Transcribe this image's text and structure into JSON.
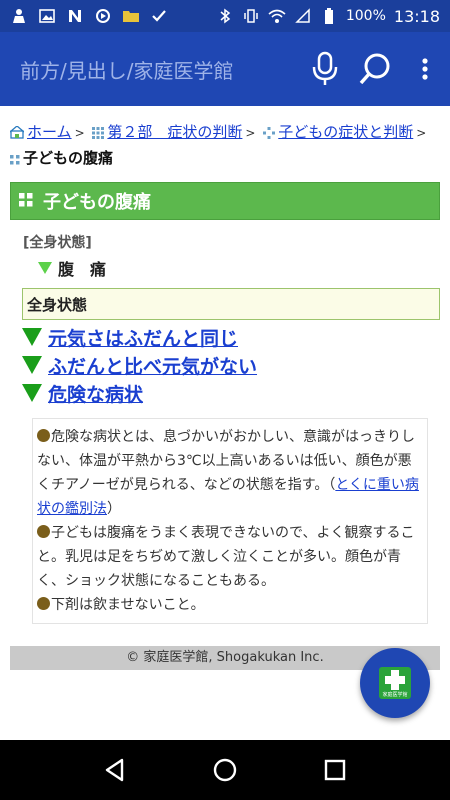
{
  "status_bar": {
    "battery": "100%",
    "time": "13:18",
    "left_icons": [
      "person-icon",
      "image-icon",
      "n-icon",
      "sync-icon",
      "folder-icon",
      "check-icon"
    ],
    "right_icons": [
      "bluetooth-icon",
      "vibrate-icon",
      "wifi-icon",
      "signal-icon",
      "battery-icon"
    ]
  },
  "app_bar": {
    "title": "前方/見出し/家庭医学館",
    "mic_icon": "microphone-icon",
    "search_icon": "search-icon",
    "menu_icon": "more-vert-icon"
  },
  "breadcrumb": {
    "home": "ホーム",
    "part": "第２部　症状の判断",
    "category": "子どもの症状と判断",
    "current": "子どもの腹痛",
    "separator": ">"
  },
  "section": {
    "title": "子どもの腹痛"
  },
  "state_label": "[全身状態]",
  "symptom": "腹　痛",
  "state_box": "全身状態",
  "choices": [
    "元気さはふだんと同じ",
    "ふだんと比べ元気がない",
    "危険な病状"
  ],
  "notes": {
    "p1_text": "危険な病状とは、息づかいがおかしい、意識がはっきりしない、体温が平熱から3℃以上高いあるいは低い、顔色が悪くチアノーゼが見られる、などの状態を指す。（",
    "p1_link": "とくに重い病状の鑑別法",
    "p1_end": "）",
    "p2": "子どもは腹痛をうまく表現できないので、よく観察すること。乳児は足をちぢめて激しく泣くことが多い。顔色が青く、ショック状態になることもある。",
    "p3": "下剤は飲ませないこと。"
  },
  "footer": "© 家庭医学館, Shogakukan Inc.",
  "fab": {
    "icon": "app-logo-icon",
    "label": "家庭医学館"
  },
  "nav_bar": {
    "back": "back-icon",
    "home": "home-icon",
    "recents": "recents-icon"
  }
}
